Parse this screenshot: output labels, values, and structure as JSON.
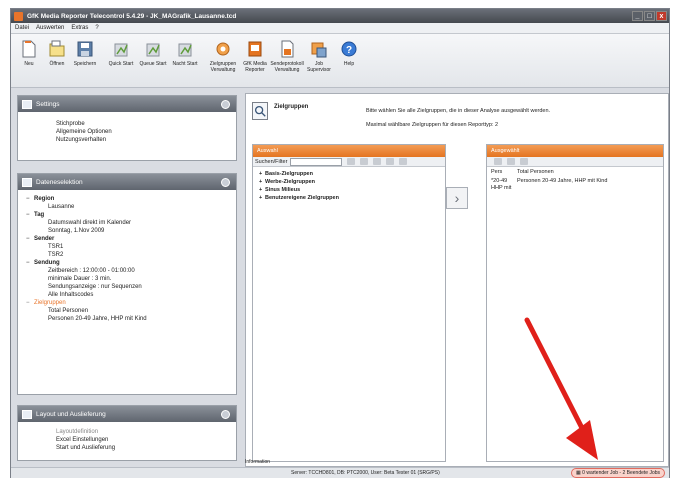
{
  "window": {
    "title": "GfK Media Reporter Telecontrol 5.4.29 - JK_MAGrafik_Lausanne.tcd",
    "controls": [
      "_",
      "□",
      "x"
    ]
  },
  "menu": [
    "Datei",
    "Auswerten",
    "Extras",
    "?"
  ],
  "toolbar": [
    {
      "label": "Neu",
      "icon": "new-document-icon"
    },
    {
      "label": "Öffnen",
      "icon": "open-folder-icon"
    },
    {
      "label": "Speichern",
      "icon": "save-icon"
    },
    {
      "label": "Quick Start",
      "icon": "quick-start-icon"
    },
    {
      "label": "Queue Start",
      "icon": "queue-start-icon"
    },
    {
      "label": "Nacht Start",
      "icon": "night-start-icon"
    },
    {
      "label": "Zielgruppen Verwaltung",
      "icon": "target-groups-icon"
    },
    {
      "label": "GfK Media Reporter",
      "icon": "media-reporter-icon"
    },
    {
      "label": "Sendeprotokoll Verwaltung",
      "icon": "broadcast-log-icon"
    },
    {
      "label": "Job Supervisor",
      "icon": "job-supervisor-icon"
    },
    {
      "label": "Help",
      "icon": "help-icon"
    }
  ],
  "settings_panel": {
    "title": "Settings",
    "items": [
      "Stichprobe",
      "Allgemeine Optionen",
      "Nutzungsverhalten"
    ]
  },
  "data_panel": {
    "title": "Dateneselektion",
    "tree": [
      {
        "text": "Region",
        "level": 0,
        "bold": true
      },
      {
        "text": "Lausanne",
        "level": 1
      },
      {
        "text": "Tag",
        "level": 0,
        "bold": true
      },
      {
        "text": "Datumswahl direkt im Kalender",
        "level": 1
      },
      {
        "text": "Sonntag, 1.Nov 2009",
        "level": 1
      },
      {
        "text": "Sender",
        "level": 0,
        "bold": true
      },
      {
        "text": "TSR1",
        "level": 1
      },
      {
        "text": "TSR2",
        "level": 1
      },
      {
        "text": "Sendung",
        "level": 0,
        "bold": true
      },
      {
        "text": "Zeitbereich :  12:00:00 - 01:00:00",
        "level": 1
      },
      {
        "text": "minimale Dauer :   3 min.",
        "level": 1
      },
      {
        "text": "Sendungsanzeige :   nur Sequenzen",
        "level": 1
      },
      {
        "text": "Alle Inhaltscodes",
        "level": 1
      },
      {
        "text": "Zielgruppen",
        "level": 0,
        "bold": false,
        "orange": true
      },
      {
        "text": "Total Personen",
        "level": 1
      },
      {
        "text": "Personen 20-49 Jahre, HHP mit Kind",
        "level": 1
      }
    ]
  },
  "layout_panel": {
    "title": "Layout und Auslieferung",
    "items": [
      "Layoutdefinition",
      "Excel Einstellungen",
      "Start und Auslieferung"
    ]
  },
  "wizard": {
    "title": "Zielgruppen",
    "desc1": "Bitte wählen Sie alle Zielgruppen, die in dieser Analyse ausgewählt werden.",
    "desc2": "Maximal wählbare Zielgruppen für diesen Reporttyp:  2"
  },
  "available": {
    "header": "Auswahl",
    "filter_label": "Suchen/Filter",
    "items": [
      "Basis-Zielgruppen",
      "Werbe-Zielgruppen",
      "Sinus Milieus",
      "Benutzereigene Zielgruppen"
    ]
  },
  "selected": {
    "header": "Ausgewählt",
    "col1": "Pers",
    "col2": "Total Personen",
    "row_code": "*20-49 HHP mit",
    "row_text": "Personen 20-49 Jahre, HHP mit Kind"
  },
  "transfer_button": "›",
  "info_label": "Information",
  "status": {
    "server": "Server: TCCHD801, DB: PTC2000, User: Beta Tester 01 (SRG/PS)",
    "jobs": "0 wartender Job - 2 Beendete Jobs"
  },
  "colors": {
    "accent_orange": "#e8742a",
    "arrow_red": "#e0201a"
  }
}
